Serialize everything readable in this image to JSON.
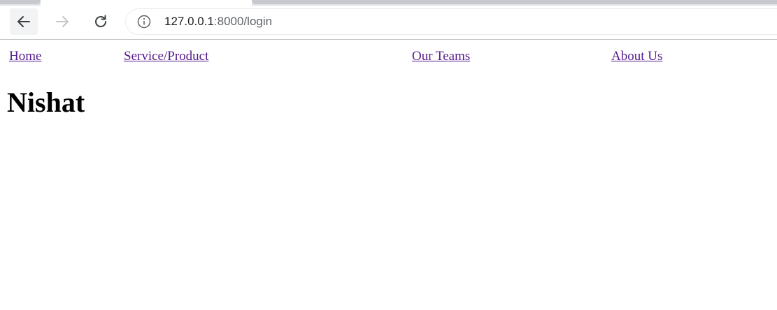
{
  "browser": {
    "url_host": "127.0.0.1",
    "url_path": ":8000/login",
    "icons": {
      "back": "arrow-left-icon",
      "forward": "arrow-right-icon",
      "reload": "reload-icon",
      "site_info": "info-icon"
    },
    "colors": {
      "chrome_bg": "#dee1e6",
      "url_host": "#202124",
      "url_path": "#5f6368"
    }
  },
  "page": {
    "nav": [
      {
        "label": "Home"
      },
      {
        "label": "Service/Product"
      },
      {
        "label": "Our Teams"
      },
      {
        "label": "About Us"
      }
    ],
    "heading": "Nishat",
    "colors": {
      "visited_link": "#551a8b",
      "heading": "#000000"
    }
  }
}
